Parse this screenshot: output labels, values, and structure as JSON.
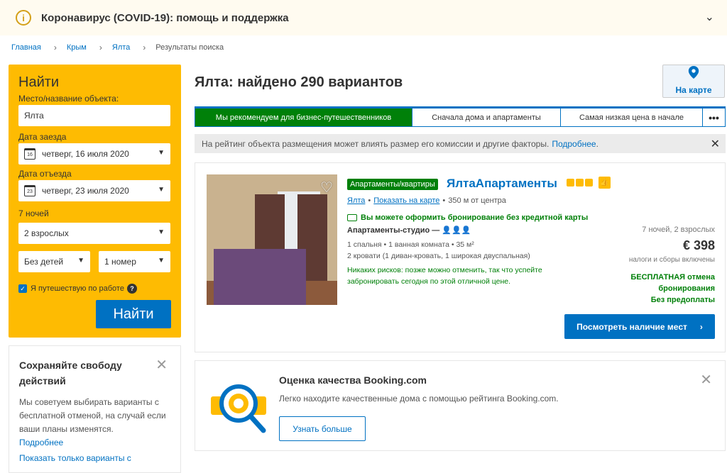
{
  "covid": {
    "title": "Коронавирус (COVID-19): помощь и поддержка",
    "icon": "info-icon"
  },
  "breadcrumb": [
    "Главная",
    "Крым",
    "Ялта",
    "Результаты поиска"
  ],
  "search": {
    "heading": "Найти",
    "destination_label": "Место/название объекта:",
    "destination_value": "Ялта",
    "checkin_label": "Дата заезда",
    "checkin_value": "четверг, 16 июля 2020",
    "checkin_day": "16",
    "checkout_label": "Дата отъезда",
    "checkout_value": "четверг, 23 июля 2020",
    "checkout_day": "23",
    "nights": "7 ночей",
    "adults": "2 взрослых",
    "children": "Без детей",
    "rooms": "1 номер",
    "business_label": "Я путешествую по работе",
    "business_checked": true,
    "button": "Найти"
  },
  "promo": {
    "title": "Сохраняйте свободу действий",
    "text": "Мы советуем выбирать варианты с бесплатной отменой, на случай если ваши планы изменятся.",
    "more_link": "Подробнее",
    "show_link": "Показать только варианты с"
  },
  "results": {
    "title": "Ялта: найдено 290 вариантов",
    "map_label": "На карте",
    "tabs": [
      "Мы рекомендуем для бизнес-путешественников",
      "Сначала дома и апартаменты",
      "Самая низкая цена в начале"
    ],
    "more_tab": "•••",
    "notice": "На рейтинг объекта размещения может влиять размер его комиссии и другие факторы.",
    "notice_link": "Подробнее"
  },
  "hotel": {
    "tag": "Апартаменты/квартиры",
    "name": "ЯлтаАпартаменты",
    "stars": 3,
    "city_link": "Ялта",
    "map_link": "Показать на карте",
    "distance": "350 м от центра",
    "no_card": "Вы можете оформить бронирование без кредитной карты",
    "room_type": "Апартаменты-студио —",
    "details_1": "1 спальня • 1 ванная комната • 35 м²",
    "details_2": "2 кровати (1 диван-кровать, 1 широкая двуспальная)",
    "risk_text": "Никаких рисков: позже можно отменить, так что успейте забронировать сегодня по этой отличной цене.",
    "price_for": "7 ночей, 2 взрослых",
    "price": "€ 398",
    "taxes": "налоги и сборы включены",
    "free_cancel_1": "БЕСПЛАТНАЯ отмена",
    "free_cancel_2": "бронирования",
    "free_cancel_3": "Без предоплаты",
    "button": "Посмотреть наличие мест"
  },
  "quality": {
    "title": "Оценка качества Booking.com",
    "text": "Легко находите качественные дома с помощью рейтинга Booking.com.",
    "button": "Узнать больше"
  },
  "colors": {
    "brand_blue": "#0071c2",
    "yellow": "#febb02",
    "green": "#008009"
  }
}
